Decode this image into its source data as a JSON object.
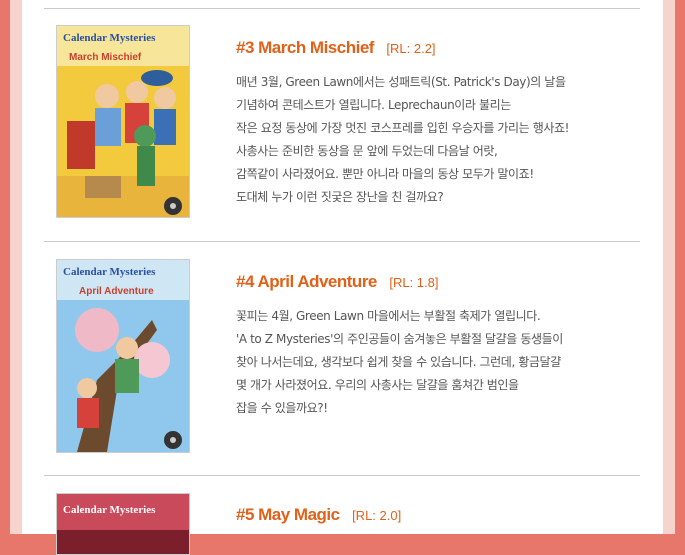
{
  "books": [
    {
      "title": "#3 March Mischief",
      "rl": "[RL: 2.2]",
      "cover_title": "March Mischief",
      "cover_series": "Calendar Mysteries",
      "lines": [
        "매년 3월, Green Lawn에서는 성패트릭(St. Patrick's Day)의 날을",
        "기념하여 콘테스트가 열립니다. Leprechaun이라 불리는",
        "작은 요정 동상에 가장 멋진 코스프레를 입힌 우승자를 가리는 행사죠!",
        "사총사는 준비한 동상을 문 앞에 두었는데 다음날 어랏,",
        "감쪽같이 사라졌어요. 뿐만 아니라 마을의 동상 모두가 말이죠!",
        "도대체 누가 이런 짓궂은 장난을 친 걸까요?"
      ]
    },
    {
      "title": "#4 April Adventure",
      "rl": "[RL: 1.8]",
      "cover_title": "April Adventure",
      "cover_series": "Calendar Mysteries",
      "lines": [
        "꽃피는 4월, Green Lawn 마을에서는 부활절 축제가 열립니다.",
        "'A to Z Mysteries'의 주인공들이 숨겨놓은 부활절 달걀을 동생들이",
        "찾아 나서는데요, 생각보다 쉽게 찾을 수 있습니다. 그런데, 황금달걀",
        "몇 개가 사라졌어요. 우리의 사총사는 달걀을 훔쳐간 범인을",
        "잡을 수 있을까요?!"
      ]
    },
    {
      "title": "#5 May Magic",
      "rl": "[RL: 2.0]",
      "cover_title": "",
      "cover_series": "Calendar Mysteries",
      "lines": []
    }
  ]
}
